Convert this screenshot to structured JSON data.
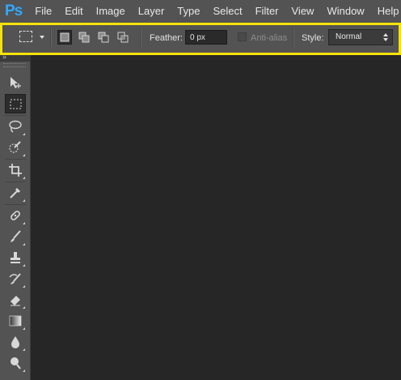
{
  "app": {
    "logo_text": "Ps"
  },
  "menu": [
    "File",
    "Edit",
    "Image",
    "Layer",
    "Type",
    "Select",
    "Filter",
    "View",
    "Window",
    "Help"
  ],
  "options_bar": {
    "feather_label": "Feather:",
    "feather_value": "0 px",
    "antialias_label": "Anti-alias",
    "antialias_checked": false,
    "style_label": "Style:",
    "style_value": "Normal",
    "highlight_color": "#f5e20a",
    "selection_modes": [
      "new-selection",
      "add-to-selection",
      "subtract-from-selection",
      "intersect-with-selection"
    ],
    "active_selection_mode": "new-selection"
  },
  "toolbar": {
    "tools": [
      "move-tool",
      "rectangular-marquee-tool",
      "lasso-tool",
      "quick-selection-tool",
      "crop-tool",
      "eyedropper-tool",
      "spot-healing-brush-tool",
      "brush-tool",
      "clone-stamp-tool",
      "history-brush-tool",
      "eraser-tool",
      "gradient-tool",
      "blur-tool",
      "dodge-tool"
    ],
    "active_tool": "rectangular-marquee-tool"
  },
  "colors": {
    "ui_panel": "#535353",
    "canvas_bg": "#262626",
    "ps_blue": "#31a8ff"
  }
}
